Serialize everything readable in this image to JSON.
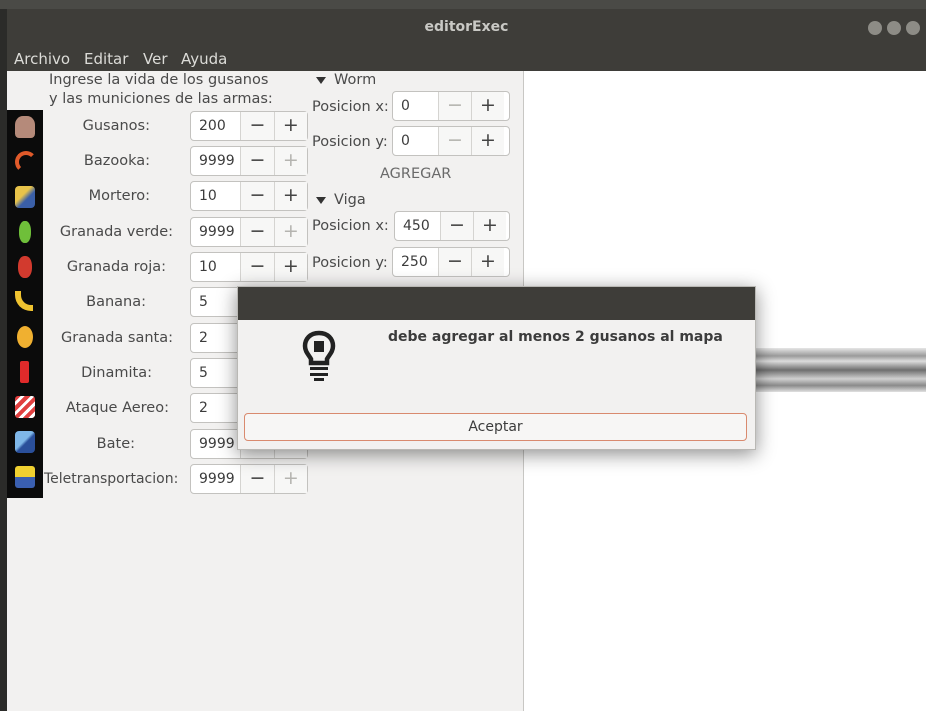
{
  "window": {
    "title": "editorExec"
  },
  "menu": [
    "Archivo",
    "Editar",
    "Ver",
    "Ayuda"
  ],
  "intro": {
    "line1": "Ingrese la vida de los gusanos",
    "line2": "y las municiones de las armas:"
  },
  "weapons": [
    {
      "label": "Gusanos:",
      "value": "200",
      "plus_disabled": false
    },
    {
      "label": "Bazooka:",
      "value": "9999",
      "plus_disabled": true
    },
    {
      "label": "Mortero:",
      "value": "10",
      "plus_disabled": false
    },
    {
      "label": "Granada verde:",
      "value": "9999",
      "plus_disabled": true
    },
    {
      "label": "Granada roja:",
      "value": "10",
      "plus_disabled": false
    },
    {
      "label": "Banana:",
      "value": "5",
      "plus_disabled": false
    },
    {
      "label": "Granada santa:",
      "value": "2",
      "plus_disabled": false
    },
    {
      "label": "Dinamita:",
      "value": "5",
      "plus_disabled": false
    },
    {
      "label": "Ataque Aereo:",
      "value": "2",
      "plus_disabled": false
    },
    {
      "label": "Bate:",
      "value": "9999",
      "plus_disabled": true
    },
    {
      "label": "Teletransportacion:",
      "value": "9999",
      "plus_disabled": true
    }
  ],
  "worm": {
    "header": "Worm",
    "pos_x_label": "Posicion x:",
    "pos_x_value": "0",
    "pos_y_label": "Posicion y:",
    "pos_y_value": "0",
    "add_label": "AGREGAR"
  },
  "viga": {
    "header": "Viga",
    "pos_x_label": "Posicion x:",
    "pos_x_value": "450",
    "pos_y_label": "Posicion y:",
    "pos_y_value": "250"
  },
  "spin": {
    "minus": "−",
    "plus": "+"
  },
  "dialog": {
    "message": "debe agregar al menos 2 gusanos al mapa",
    "accept_label": "Aceptar"
  },
  "icons": [
    "worm-icon",
    "bazooka-icon",
    "mortar-icon",
    "green-grenade-icon",
    "red-grenade-icon",
    "banana-icon",
    "holy-grenade-icon",
    "dynamite-icon",
    "air-strike-icon",
    "baseball-bat-icon",
    "teleport-icon"
  ],
  "colors": {
    "titlebar": "#3e3d39",
    "panel": "#f2f1f0",
    "accept_border": "#d98a6e"
  }
}
